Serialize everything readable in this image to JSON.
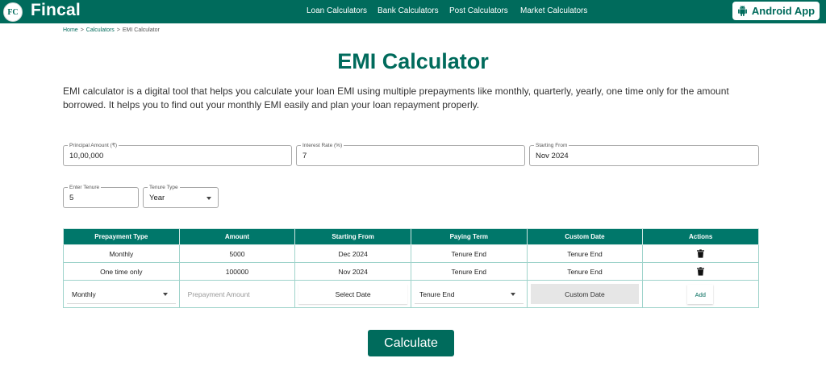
{
  "header": {
    "logo_text": "FC",
    "brand": "Fincal",
    "nav": [
      "Loan Calculators",
      "Bank Calculators",
      "Post Calculators",
      "Market Calculators"
    ],
    "android_button": "Android App"
  },
  "breadcrumb": {
    "home": "Home",
    "sep1": ">",
    "calculators": "Calculators",
    "sep2": ">",
    "current": "EMI Calculator"
  },
  "page": {
    "title": "EMI Calculator",
    "intro": "EMI calculator is a digital tool that helps you calculate your loan EMI using multiple prepayments like monthly, quarterly, yearly, one time only for the amount borrowed. It helps you to find out your monthly EMI easily and plan your loan repayment properly."
  },
  "form": {
    "principal": {
      "label": "Principal Amount (₹)",
      "value": "10,00,000"
    },
    "interest": {
      "label": "Interest Rate (%)",
      "value": "7"
    },
    "starting": {
      "label": "Starting From",
      "value": "Nov 2024"
    },
    "tenure": {
      "label": "Enter Tenure",
      "value": "5"
    },
    "tenure_type": {
      "label": "Tenure Type",
      "value": "Year"
    }
  },
  "table": {
    "headers": [
      "Prepayment Type",
      "Amount",
      "Starting From",
      "Paying Term",
      "Custom Date",
      "Actions"
    ],
    "rows": [
      [
        "Monthly",
        "5000",
        "Dec 2024",
        "Tenure End",
        "Tenure End"
      ],
      [
        "One time only",
        "100000",
        "Nov 2024",
        "Tenure End",
        "Tenure End"
      ]
    ],
    "input_row": {
      "type": "Monthly",
      "amount_placeholder": "Prepayment Amount",
      "date_button": "Select Date",
      "term": "Tenure End",
      "custom_button": "Custom Date",
      "add_button": "Add"
    }
  },
  "calculate_button": "Calculate",
  "colors": {
    "brand": "#006b5c",
    "header_row": "#00776a"
  }
}
